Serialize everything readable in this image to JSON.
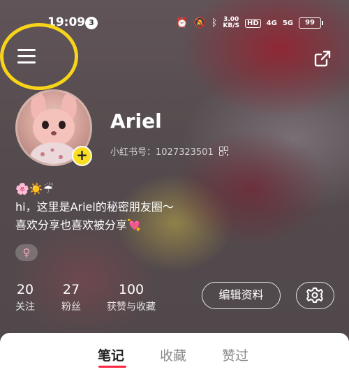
{
  "status_bar": {
    "time": "19:09",
    "notification_count": "3",
    "speed_value": "3.00",
    "speed_unit": "KB/S",
    "hd_label": "HD",
    "signal1": "4G",
    "signal2": "5G",
    "battery": "99"
  },
  "profile": {
    "username": "Ariel",
    "id_label": "小红书号：1027323501",
    "bio_emoji": "🌸☀️☔",
    "bio_line1": "hi，这里是Ariel的秘密朋友圈～",
    "bio_line2": "喜欢分享也喜欢被分享💘",
    "gender_symbol": "♀"
  },
  "stats": [
    {
      "value": "20",
      "label": "关注"
    },
    {
      "value": "27",
      "label": "粉丝"
    },
    {
      "value": "100",
      "label": "获赞与收藏"
    }
  ],
  "buttons": {
    "edit_profile": "编辑资料"
  },
  "tabs": [
    {
      "label": "笔记",
      "active": true
    },
    {
      "label": "收藏",
      "active": false
    },
    {
      "label": "赞过",
      "active": false
    }
  ],
  "colors": {
    "accent_red": "#ff2442",
    "plus_yellow": "#f9de22",
    "annotation_circle": "#f7d31a"
  }
}
